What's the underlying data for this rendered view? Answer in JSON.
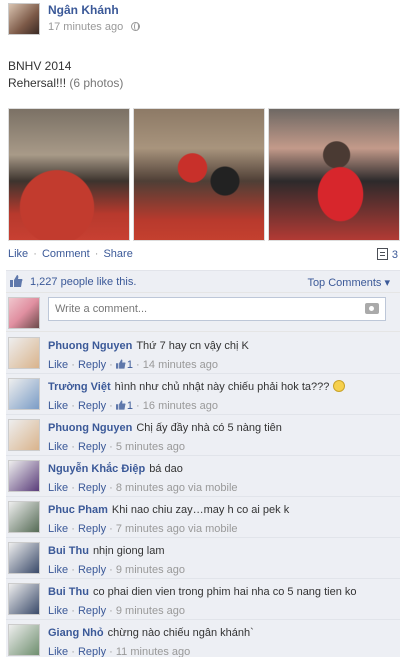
{
  "post": {
    "author": "Ngân Khánh",
    "time": "17 minutes ago",
    "title_line": "BNHV 2014",
    "text": "Rehersal!!!",
    "photo_count": "(6 photos)"
  },
  "actions": {
    "like": "Like",
    "comment": "Comment",
    "share": "Share",
    "comment_count": "3",
    "separator": "·"
  },
  "likes": {
    "text": "1,227 people like this.",
    "top_comments": "Top Comments ▾"
  },
  "composer": {
    "placeholder": "Write a comment..."
  },
  "comments": [
    {
      "name": "Phuong Nguyen",
      "text": "Thứ 7 hay cn vậy chị K",
      "like": "Like",
      "reply": "Reply",
      "likes": "1",
      "time": "14 minutes ago",
      "avatar_color": "#d9b38c"
    },
    {
      "name": "Trường Việt",
      "text": "hình như chủ nhật này chiếu phải hok ta???",
      "like": "Like",
      "reply": "Reply",
      "likes": "1",
      "time": "16 minutes ago",
      "avatar_color": "#7a9cc6"
    },
    {
      "name": "Phuong Nguyen",
      "text": "Chị ấy đầy nhà có 5 nàng tiên",
      "like": "Like",
      "reply": "Reply",
      "likes": "",
      "time": "5 minutes ago",
      "avatar_color": "#d9b38c"
    },
    {
      "name": "Nguyễn Khắc Điệp",
      "text": "bá dao",
      "like": "Like",
      "reply": "Reply",
      "likes": "",
      "time": "8 minutes ago via mobile",
      "avatar_color": "#5a3c7a"
    },
    {
      "name": "Phuc Pham",
      "text": "Khi nao chiu zay…may h co ai pek k",
      "like": "Like",
      "reply": "Reply",
      "likes": "",
      "time": "7 minutes ago via mobile",
      "avatar_color": "#556b55"
    },
    {
      "name": "Bui Thu",
      "text": "nhịn giong lam",
      "like": "Like",
      "reply": "Reply",
      "likes": "",
      "time": "9 minutes ago",
      "avatar_color": "#3a4a6a"
    },
    {
      "name": "Bui Thu",
      "text": "co phai dien vien trong phim hai nha co 5 nang tien ko",
      "like": "Like",
      "reply": "Reply",
      "likes": "",
      "time": "9 minutes ago",
      "avatar_color": "#3a4a6a"
    },
    {
      "name": "Giang Nhỏ",
      "text": "chừng nào chiếu ngân khánh`",
      "like": "Like",
      "reply": "Reply",
      "likes": "",
      "time": "11 minutes ago",
      "avatar_color": "#6f8f6f"
    }
  ],
  "colors": {
    "link": "#3b5998",
    "ufi_bg": "#edeff4"
  }
}
